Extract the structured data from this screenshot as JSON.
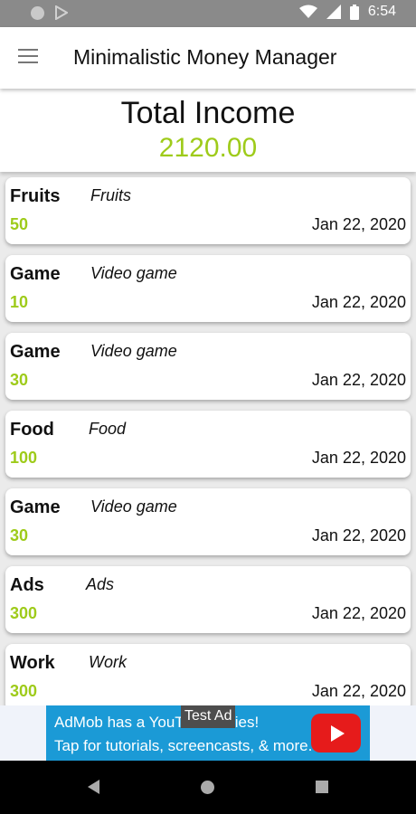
{
  "status_bar": {
    "time": "6:54",
    "icons": [
      "notification-circle-icon",
      "play-store-icon",
      "wifi-icon",
      "signal-icon",
      "battery-icon"
    ]
  },
  "app_bar": {
    "title": "Minimalistic Money Manager",
    "menu_icon": "hamburger-menu-icon"
  },
  "summary": {
    "label": "Total Income",
    "value": "2120.00"
  },
  "transactions": [
    {
      "category": "Fruits",
      "description": "Fruits",
      "amount": "50",
      "date": "Jan 22, 2020"
    },
    {
      "category": "Game",
      "description": "Video game",
      "amount": "10",
      "date": "Jan 22, 2020"
    },
    {
      "category": "Game",
      "description": "Video game",
      "amount": "30",
      "date": "Jan 22, 2020"
    },
    {
      "category": "Food",
      "description": "Food",
      "amount": "100",
      "date": "Jan 22, 2020"
    },
    {
      "category": "Game",
      "description": "Video game",
      "amount": "30",
      "date": "Jan 22, 2020"
    },
    {
      "category": "Ads",
      "description": "Ads",
      "amount": "300",
      "date": "Jan 22, 2020"
    },
    {
      "category": "Work",
      "description": "Work",
      "amount": "300",
      "date": "Jan 22, 2020"
    }
  ],
  "ad": {
    "tag": "Test Ad",
    "line1": "AdMob has a YouTube series!",
    "line2": "Tap for tutorials, screencasts, & more.",
    "icon": "youtube-play-icon"
  },
  "nav_bar": {
    "buttons": [
      "back-icon",
      "home-icon",
      "recents-icon"
    ]
  },
  "colors": {
    "accent_green": "#9ecb1a",
    "ad_blue": "#1b9ad6",
    "youtube_red": "#e61b1b"
  }
}
